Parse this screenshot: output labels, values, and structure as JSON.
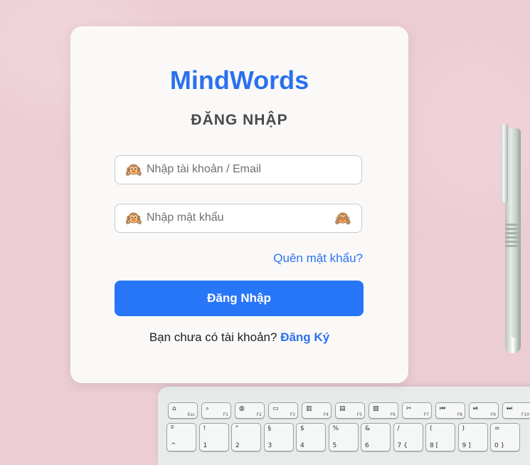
{
  "login": {
    "brand": "MindWords",
    "heading": "ĐĂNG NHẬP",
    "username_placeholder": "Nhập tài khoản / Email",
    "password_placeholder": "Nhập mật khẩu",
    "forgot_label": "Quên mật khẩu?",
    "submit_label": "Đăng Nhập",
    "signup_prompt": "Bạn chưa có tài khoản?",
    "signup_link": "Đăng Ký",
    "field_icon": "🙉",
    "toggle_icon": "🙈"
  },
  "colors": {
    "background": "#ebcdd3",
    "brand": "#2a72ee",
    "button": "#2876f8"
  },
  "keyboard": {
    "row1": [
      {
        "icon": "⌂",
        "fn": "Esc"
      },
      {
        "icon": "⌕",
        "fn": "F1"
      },
      {
        "icon": "◍",
        "fn": "F2"
      },
      {
        "icon": "▭",
        "fn": "F3"
      },
      {
        "icon": "▥",
        "fn": "F4"
      },
      {
        "icon": "▤",
        "fn": "F5"
      },
      {
        "icon": "▧",
        "fn": "F6"
      },
      {
        "icon": "✂",
        "fn": "F7"
      },
      {
        "icon": "⏮",
        "fn": "F8"
      },
      {
        "icon": "⏯",
        "fn": "F9"
      },
      {
        "icon": "⏭",
        "fn": "F10"
      }
    ],
    "row2": [
      {
        "top": "º",
        "bot": "^"
      },
      {
        "top": "!",
        "bot": "1"
      },
      {
        "top": "\"",
        "bot": "2"
      },
      {
        "top": "§",
        "bot": "3"
      },
      {
        "top": "$",
        "bot": "4"
      },
      {
        "top": "%",
        "bot": "5"
      },
      {
        "top": "&",
        "bot": "6"
      },
      {
        "top": "/",
        "bot": "7 {"
      },
      {
        "top": "(",
        "bot": "8 ["
      },
      {
        "top": ")",
        "bot": "9 ]"
      },
      {
        "top": "=",
        "bot": "0 }"
      }
    ]
  }
}
